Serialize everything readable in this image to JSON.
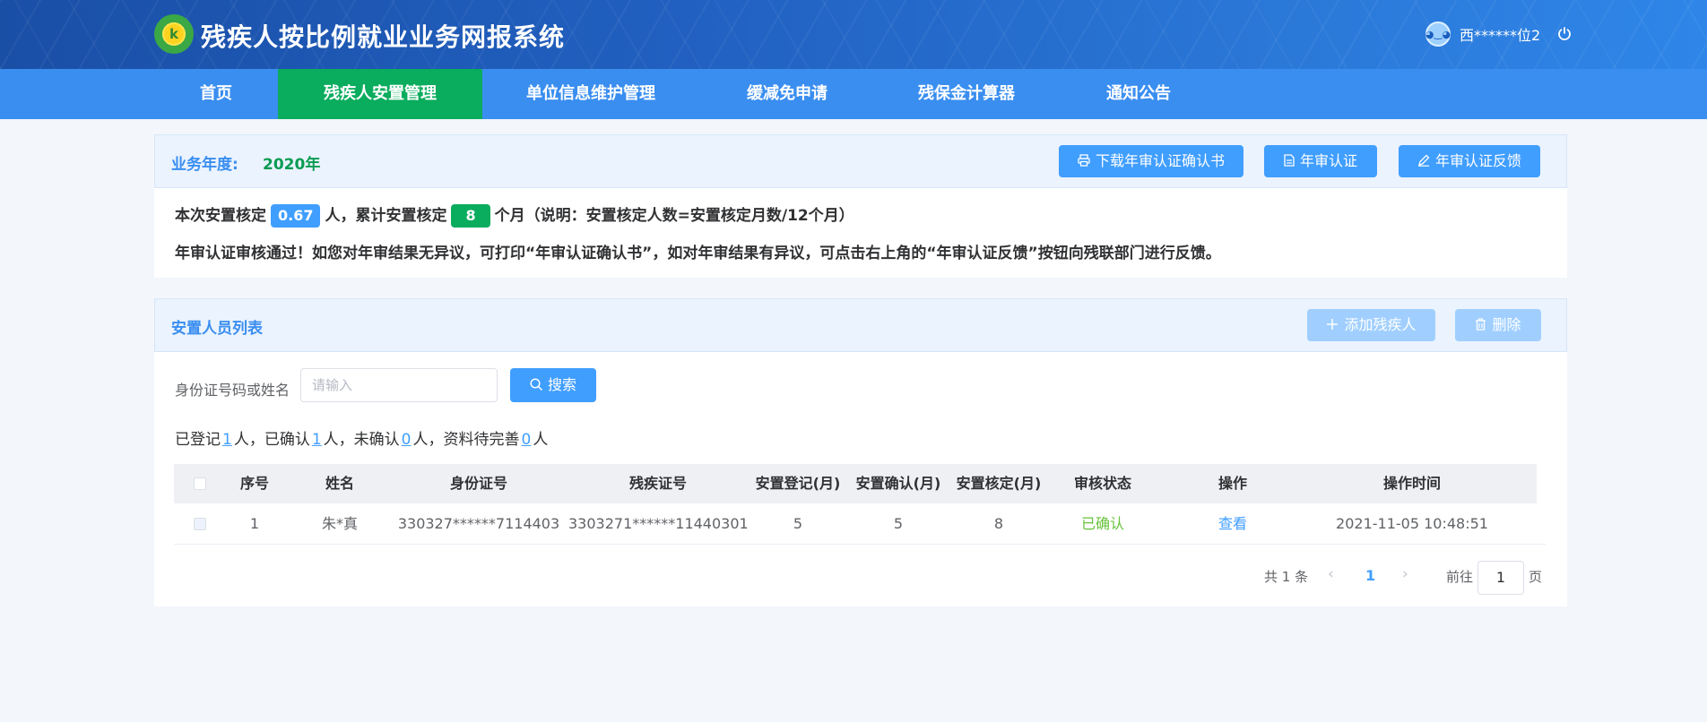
{
  "header": {
    "title": "残疾人按比例就业业务网报系统",
    "logo_text": "k",
    "user_name": "西******位2"
  },
  "nav": {
    "items": [
      {
        "label": "首页",
        "active": false
      },
      {
        "label": "残疾人安置管理",
        "active": true
      },
      {
        "label": "单位信息维护管理",
        "active": false
      },
      {
        "label": "缓减免申请",
        "active": false
      },
      {
        "label": "残保金计算器",
        "active": false
      },
      {
        "label": "通知公告",
        "active": false
      }
    ]
  },
  "annual": {
    "year_label": "业务年度:",
    "year_value": "2020年",
    "buttons": {
      "download": "下载年审认证确认书",
      "certify": "年审认证",
      "feedback": "年审认证反馈"
    },
    "summary": {
      "prefix": "本次安置核定",
      "persons": "0.67",
      "mid": "人，累计安置核定",
      "months": "8",
      "suffix": "个月（说明：安置核定人数=安置核定月数/12个月）"
    },
    "notice": "年审认证审核通过！如您对年审结果无异议，可打印“年审认证确认书”，如对年审结果有异议，可点击右上角的“年审认证反馈”按钮向残联部门进行反馈。"
  },
  "list": {
    "title": "安置人员列表",
    "buttons": {
      "add": "添加残疾人",
      "delete": "删除"
    },
    "search": {
      "label": "身份证号码或姓名",
      "placeholder": "请输入",
      "button": "搜索"
    },
    "stats": {
      "p1": "已登记",
      "registered": "1",
      "p2": "人，已确认",
      "confirmed": "1",
      "p3": "人，未确认",
      "unconfirmed": "0",
      "p4": "人，资料待完善",
      "incomplete": "0",
      "p5": "人"
    },
    "columns": [
      "序号",
      "姓名",
      "身份证号",
      "残疾证号",
      "安置登记(月)",
      "安置确认(月)",
      "安置核定(月)",
      "审核状态",
      "操作",
      "操作时间"
    ],
    "rows": [
      {
        "index": "1",
        "name": "朱*真",
        "id_no": "330327******7114403",
        "disability_no": "3303271******11440301",
        "reg_months": "5",
        "confirm_months": "5",
        "approved_months": "8",
        "status": "已确认",
        "action": "查看",
        "time": "2021-11-05 10:48:51"
      }
    ],
    "pagination": {
      "total": "共 1 条",
      "current": "1",
      "goto_prefix": "前往",
      "goto_value": "1",
      "goto_suffix": "页"
    }
  },
  "colors": {
    "primary": "#409eff",
    "nav": "#3a8ef0",
    "nav_active": "#0aac5d",
    "success": "#67c23a"
  }
}
